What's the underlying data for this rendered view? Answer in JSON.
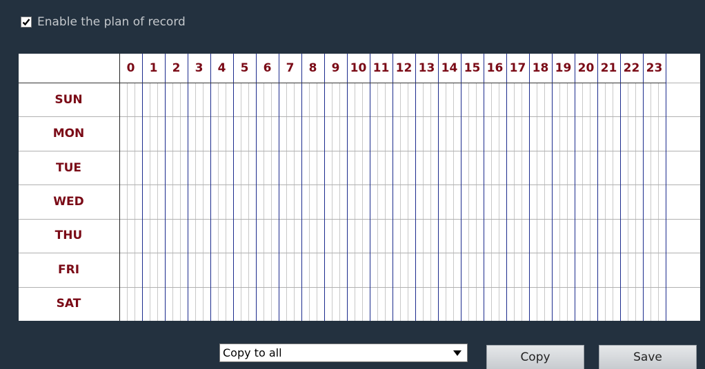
{
  "enable": {
    "label": "Enable the plan of record",
    "checked": true
  },
  "schedule": {
    "hours": [
      "0",
      "1",
      "2",
      "3",
      "4",
      "5",
      "6",
      "7",
      "8",
      "9",
      "10",
      "11",
      "12",
      "13",
      "14",
      "15",
      "16",
      "17",
      "18",
      "19",
      "20",
      "21",
      "22",
      "23"
    ],
    "days": [
      "SUN",
      "MON",
      "TUE",
      "WED",
      "THU",
      "FRI",
      "SAT"
    ],
    "colors": {
      "hour_line": "#1a2a8c",
      "sub_line": "#c8c8c8",
      "label": "#7a0a16"
    }
  },
  "copy_select": {
    "value": "Copy to all"
  },
  "buttons": {
    "copy": "Copy",
    "save": "Save"
  }
}
